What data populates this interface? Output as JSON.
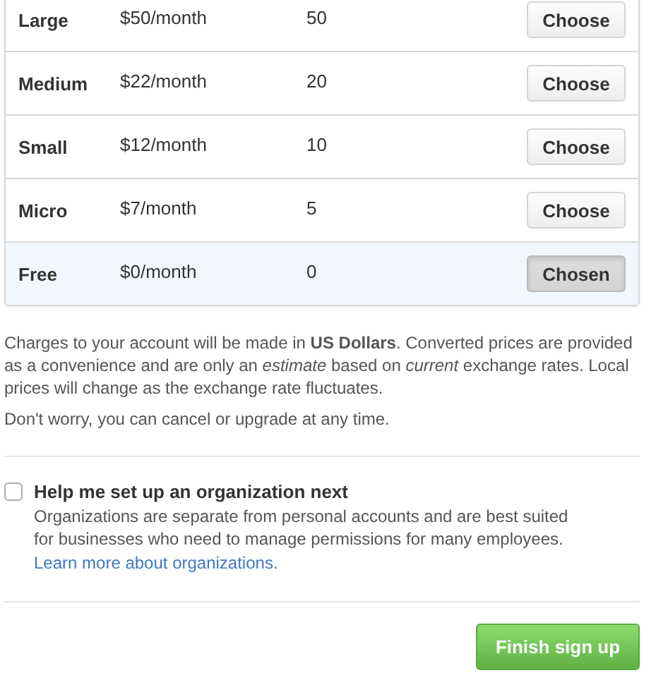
{
  "plans": [
    {
      "name": "Large",
      "price": "$50/month",
      "repos": "50",
      "button": "Choose",
      "selected": false
    },
    {
      "name": "Medium",
      "price": "$22/month",
      "repos": "20",
      "button": "Choose",
      "selected": false
    },
    {
      "name": "Small",
      "price": "$12/month",
      "repos": "10",
      "button": "Choose",
      "selected": false
    },
    {
      "name": "Micro",
      "price": "$7/month",
      "repos": "5",
      "button": "Choose",
      "selected": false
    },
    {
      "name": "Free",
      "price": "$0/month",
      "repos": "0",
      "button": "Chosen",
      "selected": true
    }
  ],
  "notes": [
    "Charges to your account will be made in **US Dollars**. Converted prices are provided as a convenience and are only an *estimate* based on *current* exchange rates. Local prices will change as the exchange rate fluctuates.",
    "Don't worry, you can cancel or upgrade at any time."
  ],
  "organization": {
    "label": "Help me set up an organization next",
    "checked": false,
    "description": "Organizations are separate from personal accounts and are best suited for businesses who need to manage permissions for many employees.",
    "link": "Learn more about organizations."
  },
  "submit": "Finish sign up"
}
